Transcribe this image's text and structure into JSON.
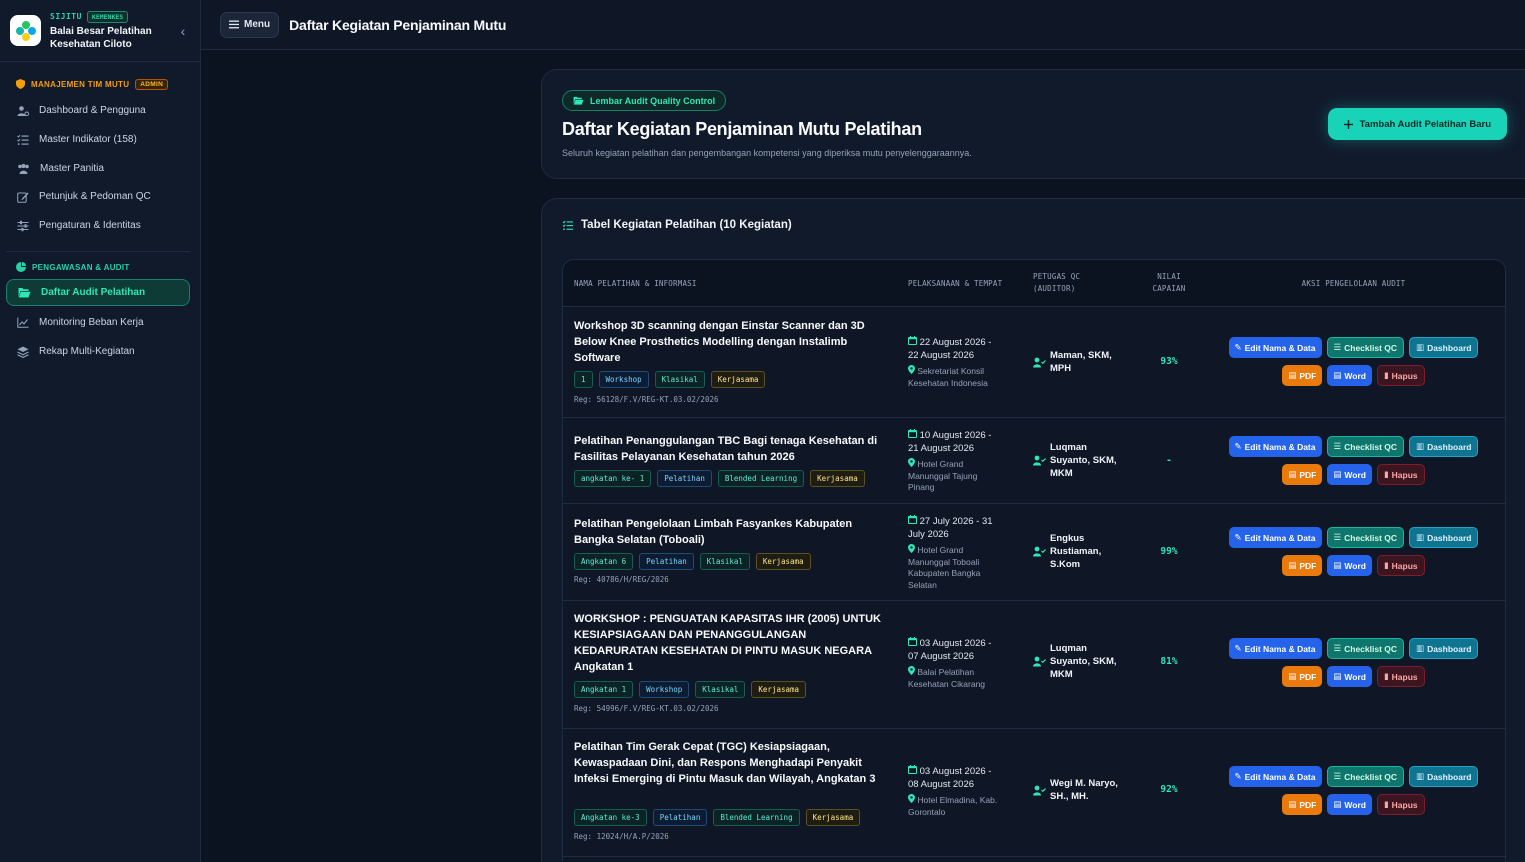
{
  "brand": {
    "app": "SIJITU",
    "badge": "KEMENKES",
    "name_line1": "Balai Besar Pelatihan",
    "name_line2": "Kesehatan Ciloto"
  },
  "sidebar": {
    "section1": {
      "title": "MANAJEMEN TIM MUTU",
      "role": "ADMIN"
    },
    "section1_items": [
      {
        "label": "Dashboard & Pengguna",
        "icon": "users-cog-icon"
      },
      {
        "label": "Master Indikator (158)",
        "icon": "list-check-icon"
      },
      {
        "label": "Master Panitia",
        "icon": "users-icon"
      },
      {
        "label": "Petunjuk & Pedoman QC",
        "icon": "edit-icon"
      },
      {
        "label": "Pengaturan & Identitas",
        "icon": "sliders-icon"
      }
    ],
    "section2": {
      "title": "PENGAWASAN & AUDIT"
    },
    "section2_items": [
      {
        "label": "Daftar Audit Pelatihan",
        "icon": "folder-open-icon",
        "active": true
      },
      {
        "label": "Monitoring Beban Kerja",
        "icon": "chart-line-icon"
      },
      {
        "label": "Rekap Multi-Kegiatan",
        "icon": "layers-icon"
      }
    ]
  },
  "topbar": {
    "menu_label": "Menu",
    "title": "Daftar Kegiatan Penjaminan Mutu"
  },
  "hero": {
    "tag": "Lembar Audit Quality Control",
    "title": "Daftar Kegiatan Penjaminan Mutu Pelatihan",
    "subtitle": "Seluruh kegiatan pelatihan dan pengembangan kompetensi yang diperiksa mutu penyelenggaraannya.",
    "add_button": "Tambah Audit Pelatihan Baru"
  },
  "table": {
    "title": "Tabel Kegiatan Pelatihan (10 Kegiatan)",
    "headers": {
      "name": "NAMA PELATIHAN & INFORMASI",
      "schedule": "PELAKSANAAN & TEMPAT",
      "auditor_line1": "PETUGAS QC",
      "auditor_line2": "(AUDITOR)",
      "score_line1": "NILAI",
      "score_line2": "CAPAIAN",
      "actions": "AKSI PENGELOLAAN AUDIT"
    },
    "action_labels": {
      "edit": "Edit Nama & Data",
      "checklist": "Checklist QC",
      "dashboard": "Dashboard",
      "pdf": "PDF",
      "word": "Word",
      "delete": "Hapus"
    },
    "rows": [
      {
        "title": "Workshop 3D scanning dengan Einstar Scanner dan 3D Below Knee Prosthetics Modelling dengan Instalimb Software",
        "chips": [
          "1",
          "Workshop",
          "Klasikal",
          "Kerjasama"
        ],
        "reg": "Reg: 56128/F.V/REG-KT.03.02/2026",
        "date1": "22 August 2026 -",
        "date2": "22 August 2026",
        "loc": [
          "Sekretariat Konsil",
          "Kesehatan Indonesia"
        ],
        "auditor": [
          "Maman, SKM,",
          "MPH"
        ],
        "score": "93%"
      },
      {
        "title": "Pelatihan Penanggulangan TBC Bagi tenaga Kesehatan di Fasilitas Pelayanan Kesehatan tahun 2026",
        "chips": [
          "angkatan ke- 1",
          "Pelatihan",
          "Blended Learning",
          "Kerjasama"
        ],
        "reg": "",
        "date1": "10 August 2026 -",
        "date2": "21 August 2026",
        "loc": [
          "Hotel Grand",
          "Manunggal Tajung",
          "Pinang"
        ],
        "auditor": [
          "Luqman",
          "Suyanto, SKM,",
          "MKM"
        ],
        "score": "-"
      },
      {
        "title": "Pelatihan Pengelolaan Limbah Fasyankes Kabupaten Bangka Selatan (Toboali)",
        "chips": [
          "Angkatan 6",
          "Pelatihan",
          "Klasikal",
          "Kerjasama"
        ],
        "reg": "Reg: 40786/H/REG/2026",
        "date1": "27 July 2026 - 31",
        "date2": "July 2026",
        "loc": [
          "Hotel Grand",
          "Manunggal Toboali",
          "Kabupaten Bangka",
          "Selatan"
        ],
        "auditor": [
          "Engkus",
          "Rustiaman,",
          "S.Kom"
        ],
        "score": "99%"
      },
      {
        "title": "WORKSHOP : PENGUATAN KAPASITAS IHR (2005) UNTUK KESIAPSIAGAAN DAN PENANGGULANGAN KEDARURATAN KESEHATAN DI PINTU MASUK NEGARA Angkatan 1",
        "chips": [
          "Angkatan 1",
          "Workshop",
          "Klasikal",
          "Kerjasama"
        ],
        "reg": "Reg: 54996/F.V/REG-KT.03.02/2026",
        "date1": "03 August 2026 -",
        "date2": "07 August 2026",
        "loc": [
          "Balai Pelatihan",
          "Kesehatan Cikarang"
        ],
        "auditor": [
          "Luqman",
          "Suyanto, SKM,",
          "MKM"
        ],
        "score": "81%"
      },
      {
        "title": "Pelatihan Tim Gerak Cepat (TGC) Kesiapsiagaan, Kewaspadaan Dini, dan Respons Menghadapi Penyakit Infeksi Emerging di Pintu Masuk dan Wilayah, Angkatan 3",
        "chips": [
          "Angkatan ke-3",
          "Pelatihan",
          "Blended Learning",
          "Kerjasama"
        ],
        "reg": "Reg: 12024/H/A.P/2026",
        "date1": "03 August 2026 -",
        "date2": "08 August 2026",
        "loc": [
          "Hotel Elmadina, Kab.",
          "Gorontalo"
        ],
        "auditor": [
          "Wegi M. Naryo,",
          "SH., MH."
        ],
        "score": "92%"
      }
    ]
  }
}
